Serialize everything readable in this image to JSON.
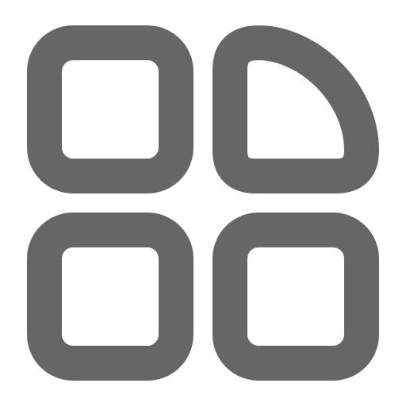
{
  "icon": {
    "name": "app-grid-icon",
    "color": "#666666",
    "background": "#ffffff",
    "tiles": [
      {
        "name": "tile-top-left",
        "shape": "rounded-square"
      },
      {
        "name": "tile-top-right",
        "shape": "quarter-circle"
      },
      {
        "name": "tile-bottom-left",
        "shape": "rounded-square"
      },
      {
        "name": "tile-bottom-right",
        "shape": "rounded-square"
      }
    ]
  }
}
